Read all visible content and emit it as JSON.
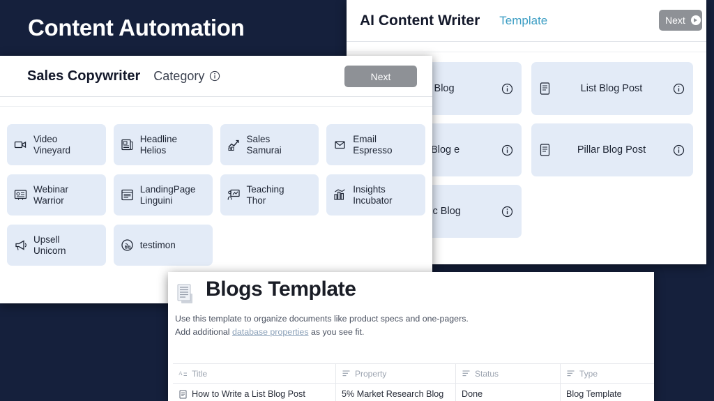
{
  "banner": {
    "title": "Content Automation",
    "background": "#15203c"
  },
  "ai_panel": {
    "app_title": "AI Content Writer",
    "section_label": "Template",
    "next_label": "Next",
    "card_color": "#e3ebf7",
    "accent_color": "#3d9ec4",
    "cards": [
      {
        "label": "o Blog",
        "icon": "document-icon"
      },
      {
        "label": "List Blog Post",
        "icon": "document-icon"
      },
      {
        "label": "al Blog\ne",
        "icon": "document-icon"
      },
      {
        "label": "Pillar Blog Post",
        "icon": "document-icon"
      },
      {
        "label": "phic Blog",
        "icon": "document-icon"
      }
    ]
  },
  "sales_panel": {
    "app_title": "Sales Copywriter",
    "section_label": "Category",
    "next_label": "Next",
    "card_color": "#e3ebf7",
    "cards": [
      {
        "label": "Video\nVineyard",
        "icon": "video-camera-icon"
      },
      {
        "label": "Headline Helios",
        "icon": "news-article-icon"
      },
      {
        "label": "Sales\nSamurai",
        "icon": "sales-chart-icon"
      },
      {
        "label": "Email\nEspresso",
        "icon": "email-icon"
      },
      {
        "label": "Webinar\nWarrior",
        "icon": "webinar-screen-icon"
      },
      {
        "label": "LandingPage\nLinguini",
        "icon": "landing-page-icon"
      },
      {
        "label": "Teaching\nThor",
        "icon": "teaching-board-icon"
      },
      {
        "label": "Insights\nIncubator",
        "icon": "bar-chart-icon"
      },
      {
        "label": "Upsell\nUnicorn",
        "icon": "megaphone-icon"
      },
      {
        "label": "testimon",
        "icon": "testimonial-icon"
      }
    ]
  },
  "blogs_template": {
    "title": "Blogs Template",
    "description_line1": "Use this template to organize documents like product specs and one-pagers.",
    "description_line2_prefix": "Add additional ",
    "description_link": "database properties",
    "description_line2_suffix": " as you see fit.",
    "table": {
      "columns": [
        {
          "label": "Title",
          "icon": "text-property-icon"
        },
        {
          "label": "Property",
          "icon": "list-property-icon"
        },
        {
          "label": "Status",
          "icon": "list-property-icon"
        },
        {
          "label": "Type",
          "icon": "list-property-icon"
        }
      ],
      "rows": [
        {
          "title": "How to Write a List Blog Post",
          "property": "5% Market Research Blog",
          "status": "Done",
          "type": "Blog Template"
        }
      ]
    }
  }
}
